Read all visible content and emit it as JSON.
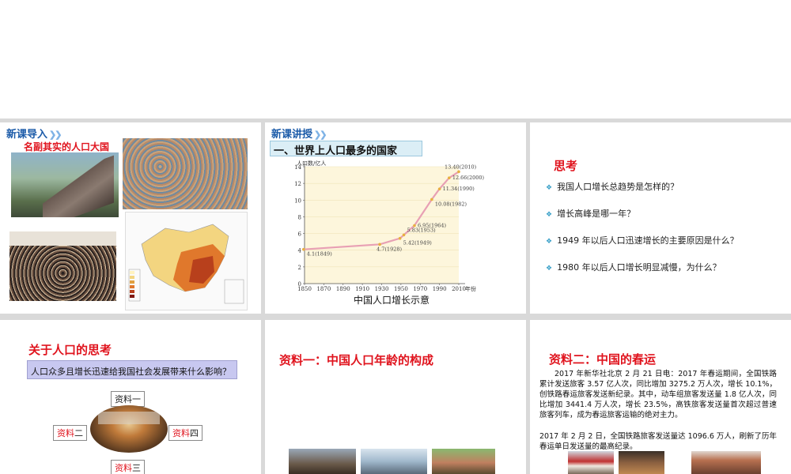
{
  "slide1": {
    "tag": "新课导入",
    "title": "名副其实的人口大国"
  },
  "slide2": {
    "tag": "新课讲授",
    "heading": "一、世界上人口最多的国家",
    "caption": "中国人口增长示意"
  },
  "chart_data": {
    "type": "line",
    "ylabel": "人口数/亿人",
    "xlabel": "年份",
    "xlim": [
      1850,
      2010
    ],
    "ylim": [
      0,
      14
    ],
    "x_ticks": [
      1850,
      1870,
      1890,
      1910,
      1930,
      1950,
      1970,
      1990,
      2010
    ],
    "y_ticks": [
      0,
      2,
      4,
      6,
      8,
      10,
      12,
      14
    ],
    "points": [
      {
        "x": 1849,
        "y": 4.1,
        "label": "4.1(1849)"
      },
      {
        "x": 1928,
        "y": 4.7,
        "label": "4.7(1928)"
      },
      {
        "x": 1949,
        "y": 5.42,
        "label": "5.42(1949)"
      },
      {
        "x": 1953,
        "y": 5.83,
        "label": "5.83(1953)"
      },
      {
        "x": 1964,
        "y": 6.95,
        "label": "6.95(1964)"
      },
      {
        "x": 1982,
        "y": 10.08,
        "label": "10.08(1982)"
      },
      {
        "x": 1990,
        "y": 11.34,
        "label": "11.34(1990)"
      },
      {
        "x": 2000,
        "y": 12.66,
        "label": "12.66(2000)"
      },
      {
        "x": 2010,
        "y": 13.4,
        "label": "13.40(2010)"
      }
    ],
    "colors": {
      "line": "#e8a0b4",
      "fill": "#fdf6dc",
      "marker": "#e8b040"
    }
  },
  "slide3": {
    "title": "思考",
    "questions": [
      "我国人口增长总趋势是怎样的？",
      "增长高峰是哪一年？",
      "1949 年以后人口迅速增长的主要原因是什么？",
      "1980 年以后人口增长明显减慢，为什么？"
    ]
  },
  "slide4": {
    "title": "关于人口的思考",
    "question": "人口众多且增长迅速给我国社会发展带来什么影响？",
    "res1_prefix": "资料",
    "res1_num": "一",
    "res2_prefix": "资料",
    "res2_num": "二",
    "res3_prefix": "资料",
    "res3_num": "三",
    "res4_prefix": "资料",
    "res4_num": "四"
  },
  "slide5": {
    "title": "资料一：中国人口年龄的构成"
  },
  "slide6": {
    "title": "资料二：中国的春运",
    "para1": "2017 年新华社北京 2 月 21 日电：2017 年春运期间，全国铁路累计发送旅客 3.57 亿人次，同比增加 3275.2 万人次，增长 10.1%，创铁路春运旅客发送新纪录。其中，动车组旅客发送量 1.8 亿人次，同比增加 3441.4 万人次，增长 23.5%，高铁旅客发送量首次超过普速旅客列车，成为春运旅客运输的绝对主力。",
    "para2": "2017 年 2 月 2 日，全国铁路旅客发送量达 1096.6 万人，刷新了历年春运单日发送量的最高纪录。"
  }
}
